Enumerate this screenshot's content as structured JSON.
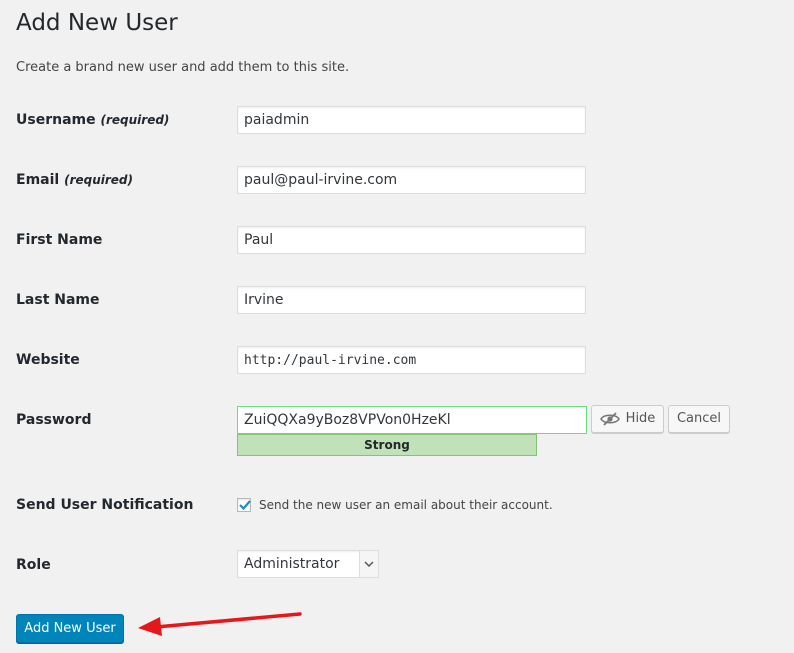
{
  "header": {
    "title": "Add New User",
    "description": "Create a brand new user and add them to this site."
  },
  "form": {
    "username": {
      "label": "Username",
      "required": "(required)",
      "value": "paiadmin"
    },
    "email": {
      "label": "Email",
      "required": "(required)",
      "value": "paul@paul-irvine.com"
    },
    "first_name": {
      "label": "First Name",
      "value": "Paul"
    },
    "last_name": {
      "label": "Last Name",
      "value": "Irvine"
    },
    "website": {
      "label": "Website",
      "value": "http://paul-irvine.com"
    },
    "password": {
      "label": "Password",
      "value": "ZuiQQXa9yBoz8VPVon0HzeKl",
      "strength": "Strong",
      "hide_label": "Hide",
      "cancel_label": "Cancel"
    },
    "notification": {
      "label": "Send User Notification",
      "checkbox_label": "Send the new user an email about their account.",
      "checked": true
    },
    "role": {
      "label": "Role",
      "value": "Administrator"
    },
    "submit_label": "Add New User"
  },
  "colors": {
    "primary": "#0085ba",
    "strength_bg": "#c1e1b9",
    "annotation_arrow": "#e5171b"
  },
  "icons": {
    "hide": "eye-slash-icon",
    "select": "chevron-down-icon",
    "checkbox": "checkmark-icon",
    "annotation": "red-arrow-icon"
  }
}
